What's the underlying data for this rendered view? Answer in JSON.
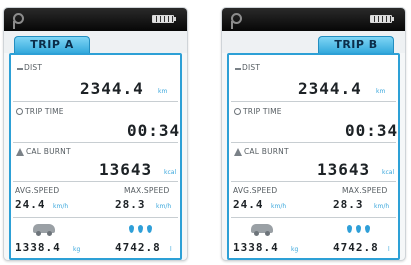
{
  "devices": [
    {
      "tab": "TRIP A",
      "dist_label": "DIST",
      "dist_value": "2344.4",
      "dist_unit": "km",
      "time_label": "TRIP TIME",
      "time_value": "00:34",
      "cal_label": "CAL BURNT",
      "cal_value": "13643",
      "cal_unit": "kcal",
      "avg_label": "AVG.SPEED",
      "avg_value": "24.4",
      "avg_unit": "km/h",
      "max_label": "MAX.SPEED",
      "max_value": "28.3",
      "max_unit": "km/h",
      "co2_value": "1338.4",
      "co2_unit": "kg",
      "fuel_value": "4742.8",
      "fuel_unit": "l"
    },
    {
      "tab": "TRIP B",
      "dist_label": "DIST",
      "dist_value": "2344.4",
      "dist_unit": "km",
      "time_label": "TRIP TIME",
      "time_value": "00:34",
      "cal_label": "CAL BURNT",
      "cal_value": "13643",
      "cal_unit": "kcal",
      "avg_label": "AVG.SPEED",
      "avg_value": "24.4",
      "avg_unit": "km/h",
      "max_label": "MAX.SPEED",
      "max_value": "28.3",
      "max_unit": "km/h",
      "co2_value": "1338.4",
      "co2_unit": "kg",
      "fuel_value": "4742.8",
      "fuel_unit": "l"
    }
  ],
  "icons": {
    "logo": "logo-icon",
    "battery": "battery-icon",
    "distance": "dash-icon",
    "time": "clock-icon",
    "calories": "flame-icon",
    "co2": "car-icon",
    "fuel": "drops-icon"
  },
  "colors": {
    "accent": "#2da0d6",
    "tab": "#4bb8e6",
    "topbar": "#111111",
    "text": "#1d2226"
  }
}
